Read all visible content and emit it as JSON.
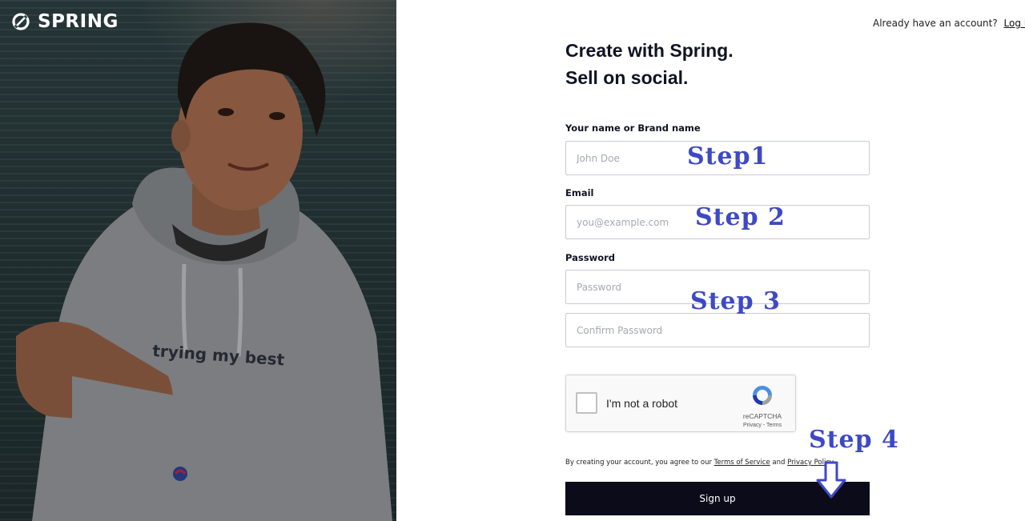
{
  "brand": {
    "name": "SPRING"
  },
  "topbar": {
    "prompt": "Already have an account?",
    "login_label": "Log In"
  },
  "headline": {
    "line1": "Create with Spring.",
    "line2": "Sell on social."
  },
  "form": {
    "name": {
      "label": "Your name or Brand name",
      "placeholder": "John Doe",
      "value": ""
    },
    "email": {
      "label": "Email",
      "placeholder": "you@example.com",
      "value": ""
    },
    "password": {
      "label": "Password",
      "placeholder": "Password",
      "value": ""
    },
    "confirm_password": {
      "placeholder": "Confirm Password",
      "value": ""
    }
  },
  "captcha": {
    "label": "I'm not a robot",
    "brand": "reCAPTCHA",
    "links": "Privacy - Terms",
    "checked": false
  },
  "consent": {
    "prefix": "By creating your account, you agree to our",
    "terms_label": "Terms of Service",
    "and": "and",
    "privacy_label": "Privacy Policy"
  },
  "signup_label": "Sign up",
  "hero": {
    "shirt_text": "trying my best"
  },
  "annotations": {
    "step1": "Step1",
    "step2": "Step 2",
    "step3": "Step 3",
    "step4": "Step 4"
  },
  "colors": {
    "button_bg": "#0c0b19",
    "annotation": "#3e49c4",
    "input_border": "#c9ccd2"
  },
  "icons": [
    "spring-logo-icon",
    "recaptcha-icon",
    "down-arrow-icon"
  ]
}
